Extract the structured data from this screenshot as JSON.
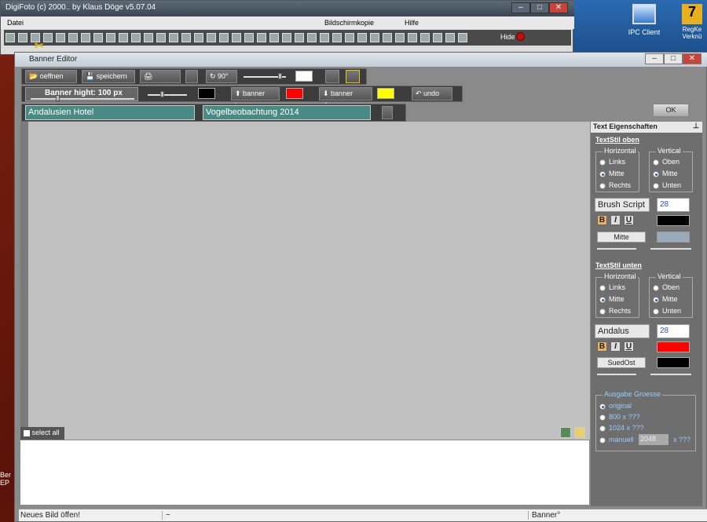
{
  "main_window": {
    "title": "DigiFoto (c) 2000.. by Klaus Döge v5.07.04",
    "menu": {
      "datei": "Datei",
      "bildschirmkopie": "Bildschirmkopie",
      "hilfe": "Hilfe"
    },
    "hide_label": "Hide"
  },
  "desktop": {
    "icons": [
      {
        "label": "IPC Client",
        "icon": "monitor-icon"
      },
      {
        "label": "RegKe Verknü",
        "icon": "shortcut-icon"
      }
    ],
    "left_text": "Ber EP"
  },
  "editor": {
    "title": "Banner Editor",
    "toolbar1": {
      "open": "oeffnen",
      "save": "speichern",
      "print": "drucken",
      "rotate": "90°",
      "color1": "#ffffff"
    },
    "toolbar2": {
      "banner_height": "Banner hight: 100 px",
      "banner_height_value": 100,
      "color_main": "#000000",
      "banner_top": "banner top",
      "banner_top_color": "#ff0000",
      "banner_down": "banner down",
      "banner_down_color": "#ffff00",
      "undo": "undo"
    },
    "text_top": "Andalusien Hotel",
    "text_bottom": "Vogelbeobachtung 2014",
    "ok": "OK",
    "select_all": "select all",
    "status": {
      "left": "Neues Bild öffen!",
      "middle": "~",
      "right": "Banner°"
    }
  },
  "panel": {
    "title": "Text Eigenschaften",
    "top": {
      "heading": "TextStil oben",
      "horizontal_label": "Horizontal",
      "horizontal": [
        "Links",
        "Mitte",
        "Rechts"
      ],
      "horizontal_selected": "Mitte",
      "vertical_label": "Vertical",
      "vertical": [
        "Oben",
        "Mitte",
        "Unten"
      ],
      "vertical_selected": "Mitte",
      "font": "Brush Script",
      "size": "28",
      "bold": "B",
      "italic": "I",
      "underline": "U",
      "color": "#000000",
      "align": "Mitte"
    },
    "bottom": {
      "heading": "TextStil unten",
      "horizontal_label": "Horizontal",
      "horizontal": [
        "Links",
        "Mitte",
        "Rechts"
      ],
      "horizontal_selected": "Mitte",
      "vertical_label": "Vertical",
      "vertical": [
        "Oben",
        "Mitte",
        "Unten"
      ],
      "vertical_selected": "Mitte",
      "font": "Andalus",
      "size": "28",
      "bold": "B",
      "italic": "I",
      "underline": "U",
      "color": "#ff0000",
      "align": "SuedOst",
      "shadow_color": "#000000"
    },
    "output": {
      "label": "Ausgabe Groesse",
      "options": [
        "original",
        "800 x ???",
        "1024 x ???",
        "manuell"
      ],
      "selected": "original",
      "manual_value": "2048",
      "manual_suffix": "x ???"
    }
  }
}
